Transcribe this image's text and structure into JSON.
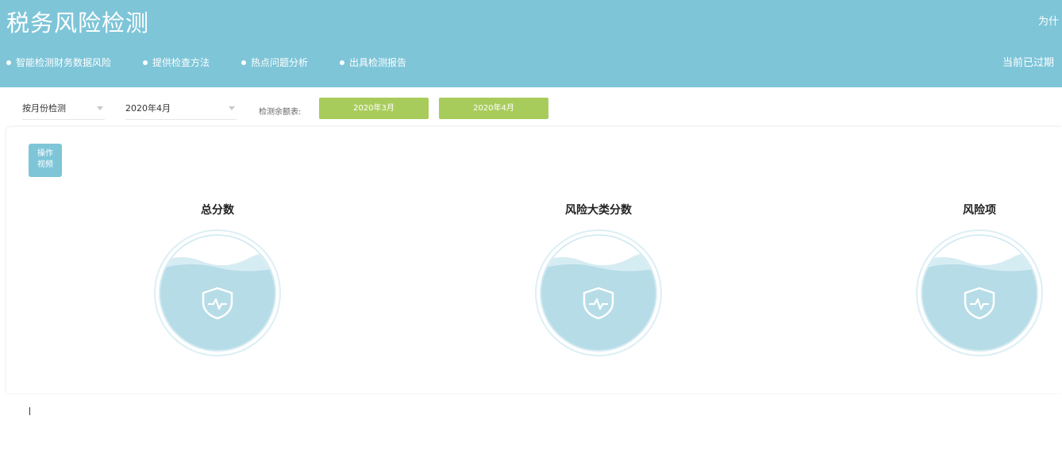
{
  "header": {
    "title": "税务风险检测",
    "top_right": "为什",
    "expired_text": "当前已过期",
    "features": [
      "智能检测财务数据风险",
      "提供检查方法",
      "热点问题分析",
      "出具检测报告"
    ]
  },
  "toolbar": {
    "mode_select": "按月份检测",
    "month_select": "2020年4月",
    "balance_label": "检测余额表:",
    "month_buttons": [
      "2020年3月",
      "2020年4月"
    ]
  },
  "panel": {
    "video_button": [
      "操作",
      "视频"
    ],
    "metrics": [
      {
        "title": "总分数"
      },
      {
        "title": "风险大类分数"
      },
      {
        "title": "风险项"
      }
    ]
  },
  "colors": {
    "header_bg": "#7ec5d8",
    "button_green": "#a8cc5b",
    "gauge_fill": "#b6dce7",
    "gauge_ring": "#dceff5"
  },
  "icons": [
    "shield-pulse-icon",
    "bullet-dot-icon",
    "chevron-down-icon"
  ]
}
